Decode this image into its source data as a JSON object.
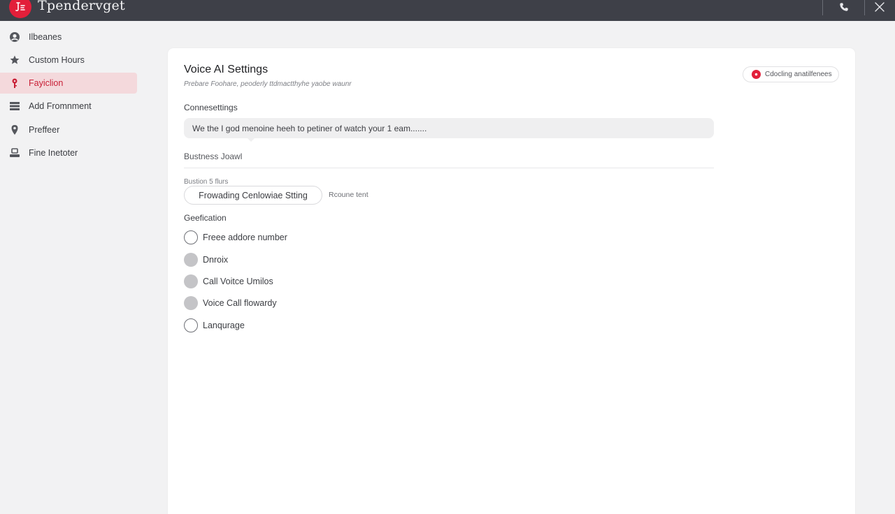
{
  "titlebar": {
    "app_title": "Tpendervget",
    "colors": {
      "bar": "#3e4048",
      "logo": "#e21f3a"
    },
    "icons": [
      "app-logo-icon",
      "phone-icon",
      "close-icon"
    ]
  },
  "sidebar": {
    "items": [
      {
        "label": "Ilbeanes",
        "icon": "user-circle-icon",
        "active": false
      },
      {
        "label": "Custom Hours",
        "icon": "star-icon",
        "active": false
      },
      {
        "label": "Fayiclion",
        "icon": "key-icon",
        "active": true
      },
      {
        "label": "Add Fromnment",
        "icon": "list-icon",
        "active": false
      },
      {
        "label": "Preffeer",
        "icon": "location-pin-icon",
        "active": false
      },
      {
        "label": "Fine Inetoter",
        "icon": "users-icon",
        "active": false
      }
    ],
    "active_color": "#c81e35",
    "active_background": "#f4d9dc"
  },
  "main": {
    "title": "Voice AI Settings",
    "subtitle": "Prebare  Foohare, peoderly ttdmactthyhe yaobe waunr",
    "status_badge": "Cdocling anatilfenees",
    "connect_label": "Connesettings",
    "message_value": "We the I god menoine heeh to petiner of watch your 1 eam.......",
    "business_label": "Bustness Joawl",
    "hours_label": "Bustion 5 flurs",
    "forwarding_button": "Frowading Cenlowiae Stting",
    "reconnect_link": "Rcoune tent",
    "options_label": "Geefication",
    "options": [
      {
        "label": "Freee addore number",
        "state": "empty"
      },
      {
        "label": "Dnroix",
        "state": "filled"
      },
      {
        "label": "Call Voitce Umilos",
        "state": "filled"
      },
      {
        "label": "Voice Call flowardy",
        "state": "filled"
      },
      {
        "label": "Lanqurage",
        "state": "empty"
      }
    ]
  }
}
